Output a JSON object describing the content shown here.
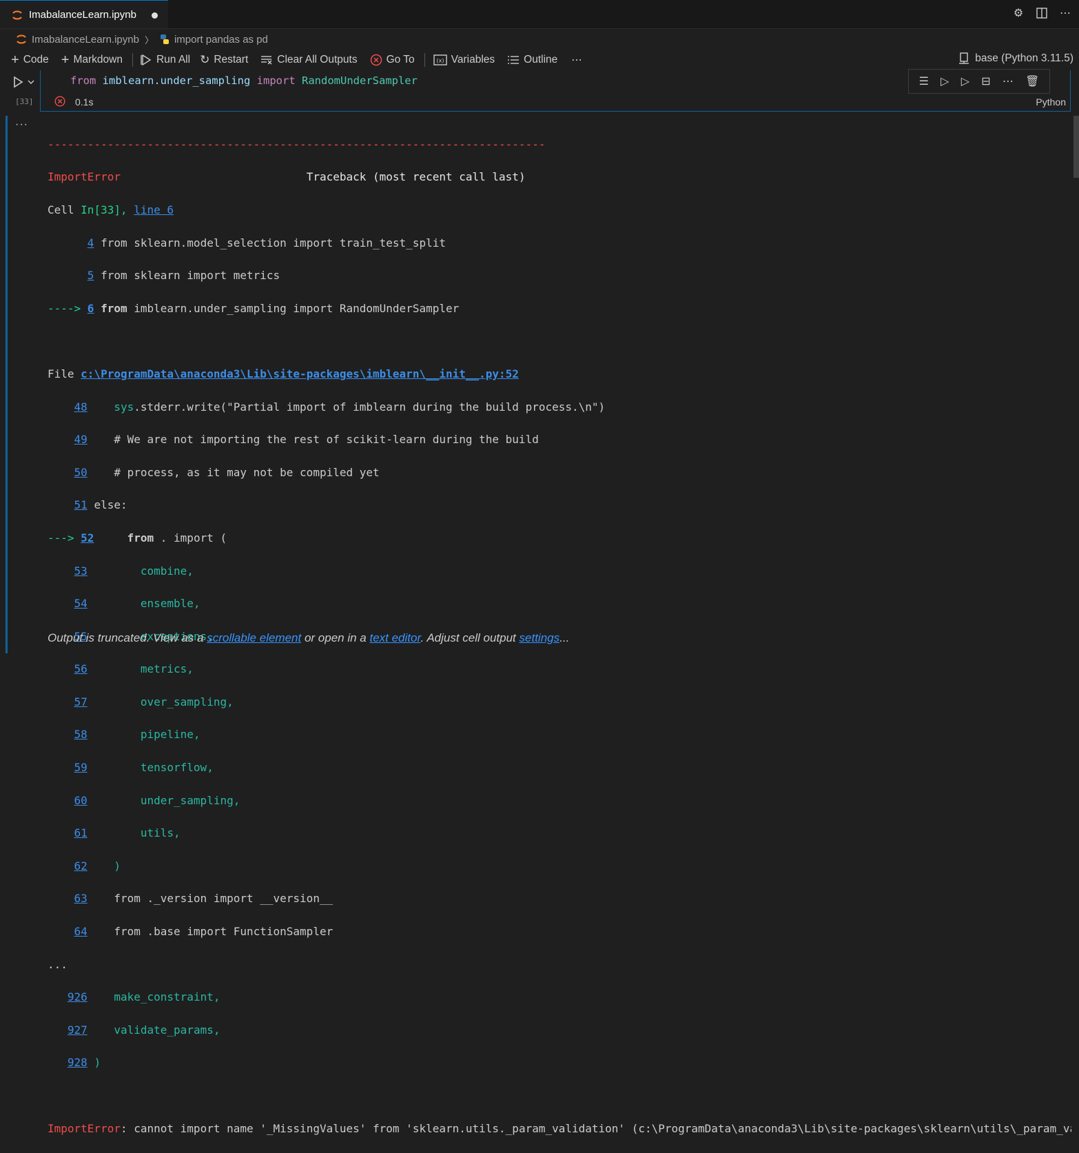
{
  "tab": {
    "filename": "ImabalanceLearn.ipynb"
  },
  "breadcrumb": {
    "file": "ImabalanceLearn.ipynb",
    "symbol": "import pandas as pd"
  },
  "toolbar": {
    "code": "Code",
    "markdown": "Markdown",
    "run_all": "Run All",
    "restart": "Restart",
    "clear_outputs": "Clear All Outputs",
    "go_to": "Go To",
    "variables": "Variables",
    "outline": "Outline",
    "more": "⋯",
    "kernel": "base (Python 3.11.5)"
  },
  "cell": {
    "exec_count": "[33]",
    "code": {
      "kw1": "from",
      "module": "imblearn.under_sampling",
      "kw2": "import",
      "cls": "RandomUnderSampler"
    },
    "time": "0.1s",
    "language": "Python"
  },
  "output": {
    "dashes": "---------------------------------------------------------------------------",
    "err_name": "ImportError",
    "traceback_hdr": "                            Traceback (most recent call last)",
    "cell_prefix": "Cell ",
    "cell_in": "In[33], ",
    "cell_line": "line 6",
    "l4_no": "4",
    "l4": " from sklearn.model_selection import train_test_split",
    "l5_no": "5",
    "l5": " from sklearn import metrics",
    "l6_arrow": "----> ",
    "l6_no": "6",
    "l6_kw": "from",
    "l6": " imblearn.under_sampling import RandomUnderSampler",
    "file_prefix": "File ",
    "file_path": "c:\\ProgramData\\anaconda3\\Lib\\site-packages\\imblearn\\__init__.py:52",
    "lines": [
      {
        "no": "48",
        "pre": "    ",
        "text": "sys",
        "rest": ".stderr.write(\"Partial import of imblearn during the build process.\\n\")"
      },
      {
        "no": "49",
        "pre": "    ",
        "text": "# We are not importing the rest of scikit-learn during the build",
        "rest": ""
      },
      {
        "no": "50",
        "pre": "    ",
        "text": "# process, as it may not be compiled yet",
        "rest": ""
      },
      {
        "no": "51",
        "pre": "",
        "text": "else:",
        "rest": ""
      }
    ],
    "arrow52": "---> ",
    "no52": "52",
    "kw52": "from",
    "rest52": " . import (",
    "modules": [
      {
        "no": "53",
        "name": "combine,"
      },
      {
        "no": "54",
        "name": "ensemble,"
      },
      {
        "no": "55",
        "name": "exceptions,"
      },
      {
        "no": "56",
        "name": "metrics,"
      },
      {
        "no": "57",
        "name": "over_sampling,"
      },
      {
        "no": "58",
        "name": "pipeline,"
      },
      {
        "no": "59",
        "name": "tensorflow,"
      },
      {
        "no": "60",
        "name": "under_sampling,"
      },
      {
        "no": "61",
        "name": "utils,"
      }
    ],
    "no62": "62",
    "l62": ")",
    "no63": "63",
    "l63": "from ._version import __version__",
    "no64": "64",
    "l64": "from .base import FunctionSampler",
    "ellipsis": "...",
    "no926": "926",
    "l926": "make_constraint,",
    "no927": "927",
    "l927": "validate_params,",
    "no928": "928",
    "l928": ")",
    "final_err": "ImportError",
    "final_msg": ": cannot import name '_MissingValues' from 'sklearn.utils._param_validation' (c:\\ProgramData\\anaconda3\\Lib\\site-packages\\sklearn\\utils\\_param_validation.py)"
  },
  "truncated": {
    "pre": "Output is truncated. View as a ",
    "link1": "scrollable element",
    "mid": " or open in a ",
    "link2": "text editor",
    "mid2": ". Adjust cell output ",
    "link3": "settings",
    "post": "..."
  }
}
